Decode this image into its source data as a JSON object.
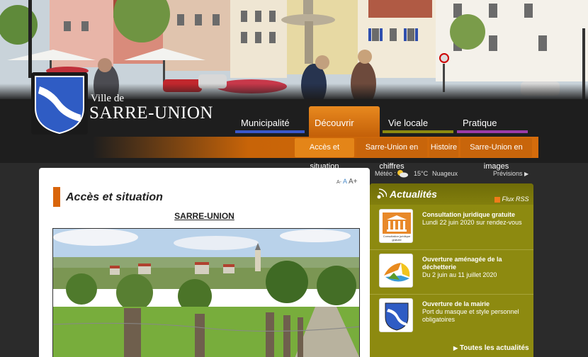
{
  "logo": {
    "ville": "Ville de",
    "name": "SARRE-UNION",
    "shield_colors": [
      "#1e4fb3",
      "#ffffff"
    ]
  },
  "nav": {
    "items": [
      {
        "label": "Municipalité",
        "color": "#3a58c9"
      },
      {
        "label": "Découvrir",
        "color": "#e8891f"
      },
      {
        "label": "Vie locale",
        "color": "#8c8a10"
      },
      {
        "label": "Pratique",
        "color": "#9a3ba8"
      }
    ],
    "active": "Découvrir"
  },
  "subnav": {
    "items": [
      "Accès et situation",
      "Sarre-Union en chiffres",
      "Histoire",
      "Sarre-Union en images"
    ],
    "active": "Accès et situation"
  },
  "content": {
    "title": "Accès et situation",
    "font_controls": [
      "A-",
      "A",
      "A+"
    ],
    "section_heading": "SARRE-UNION"
  },
  "weather": {
    "label": "Météo :",
    "icon": "partly-cloudy-icon",
    "temperature": "15°C",
    "description": "Nuageux",
    "forecast_link": "Prévisions"
  },
  "news": {
    "title": "Actualités",
    "rss_label": "Flux RSS",
    "items": [
      {
        "title": "Consultation juridique gratuite",
        "subtitle": "Lundi 22 juin 2020 sur rendez-vous",
        "thumb_caption": "Consultation juridique gratuite",
        "icon": "courthouse-icon"
      },
      {
        "title": "Ouverture aménagée de la déchetterie",
        "subtitle": "Du 2 juin au 11 juillet 2020",
        "icon": "recycling-icon"
      },
      {
        "title": "Ouverture de la mairie",
        "subtitle": "Port du masque et style personnel obligatoires",
        "icon": "shield-icon"
      }
    ],
    "all_link": "Toutes les actualités"
  }
}
